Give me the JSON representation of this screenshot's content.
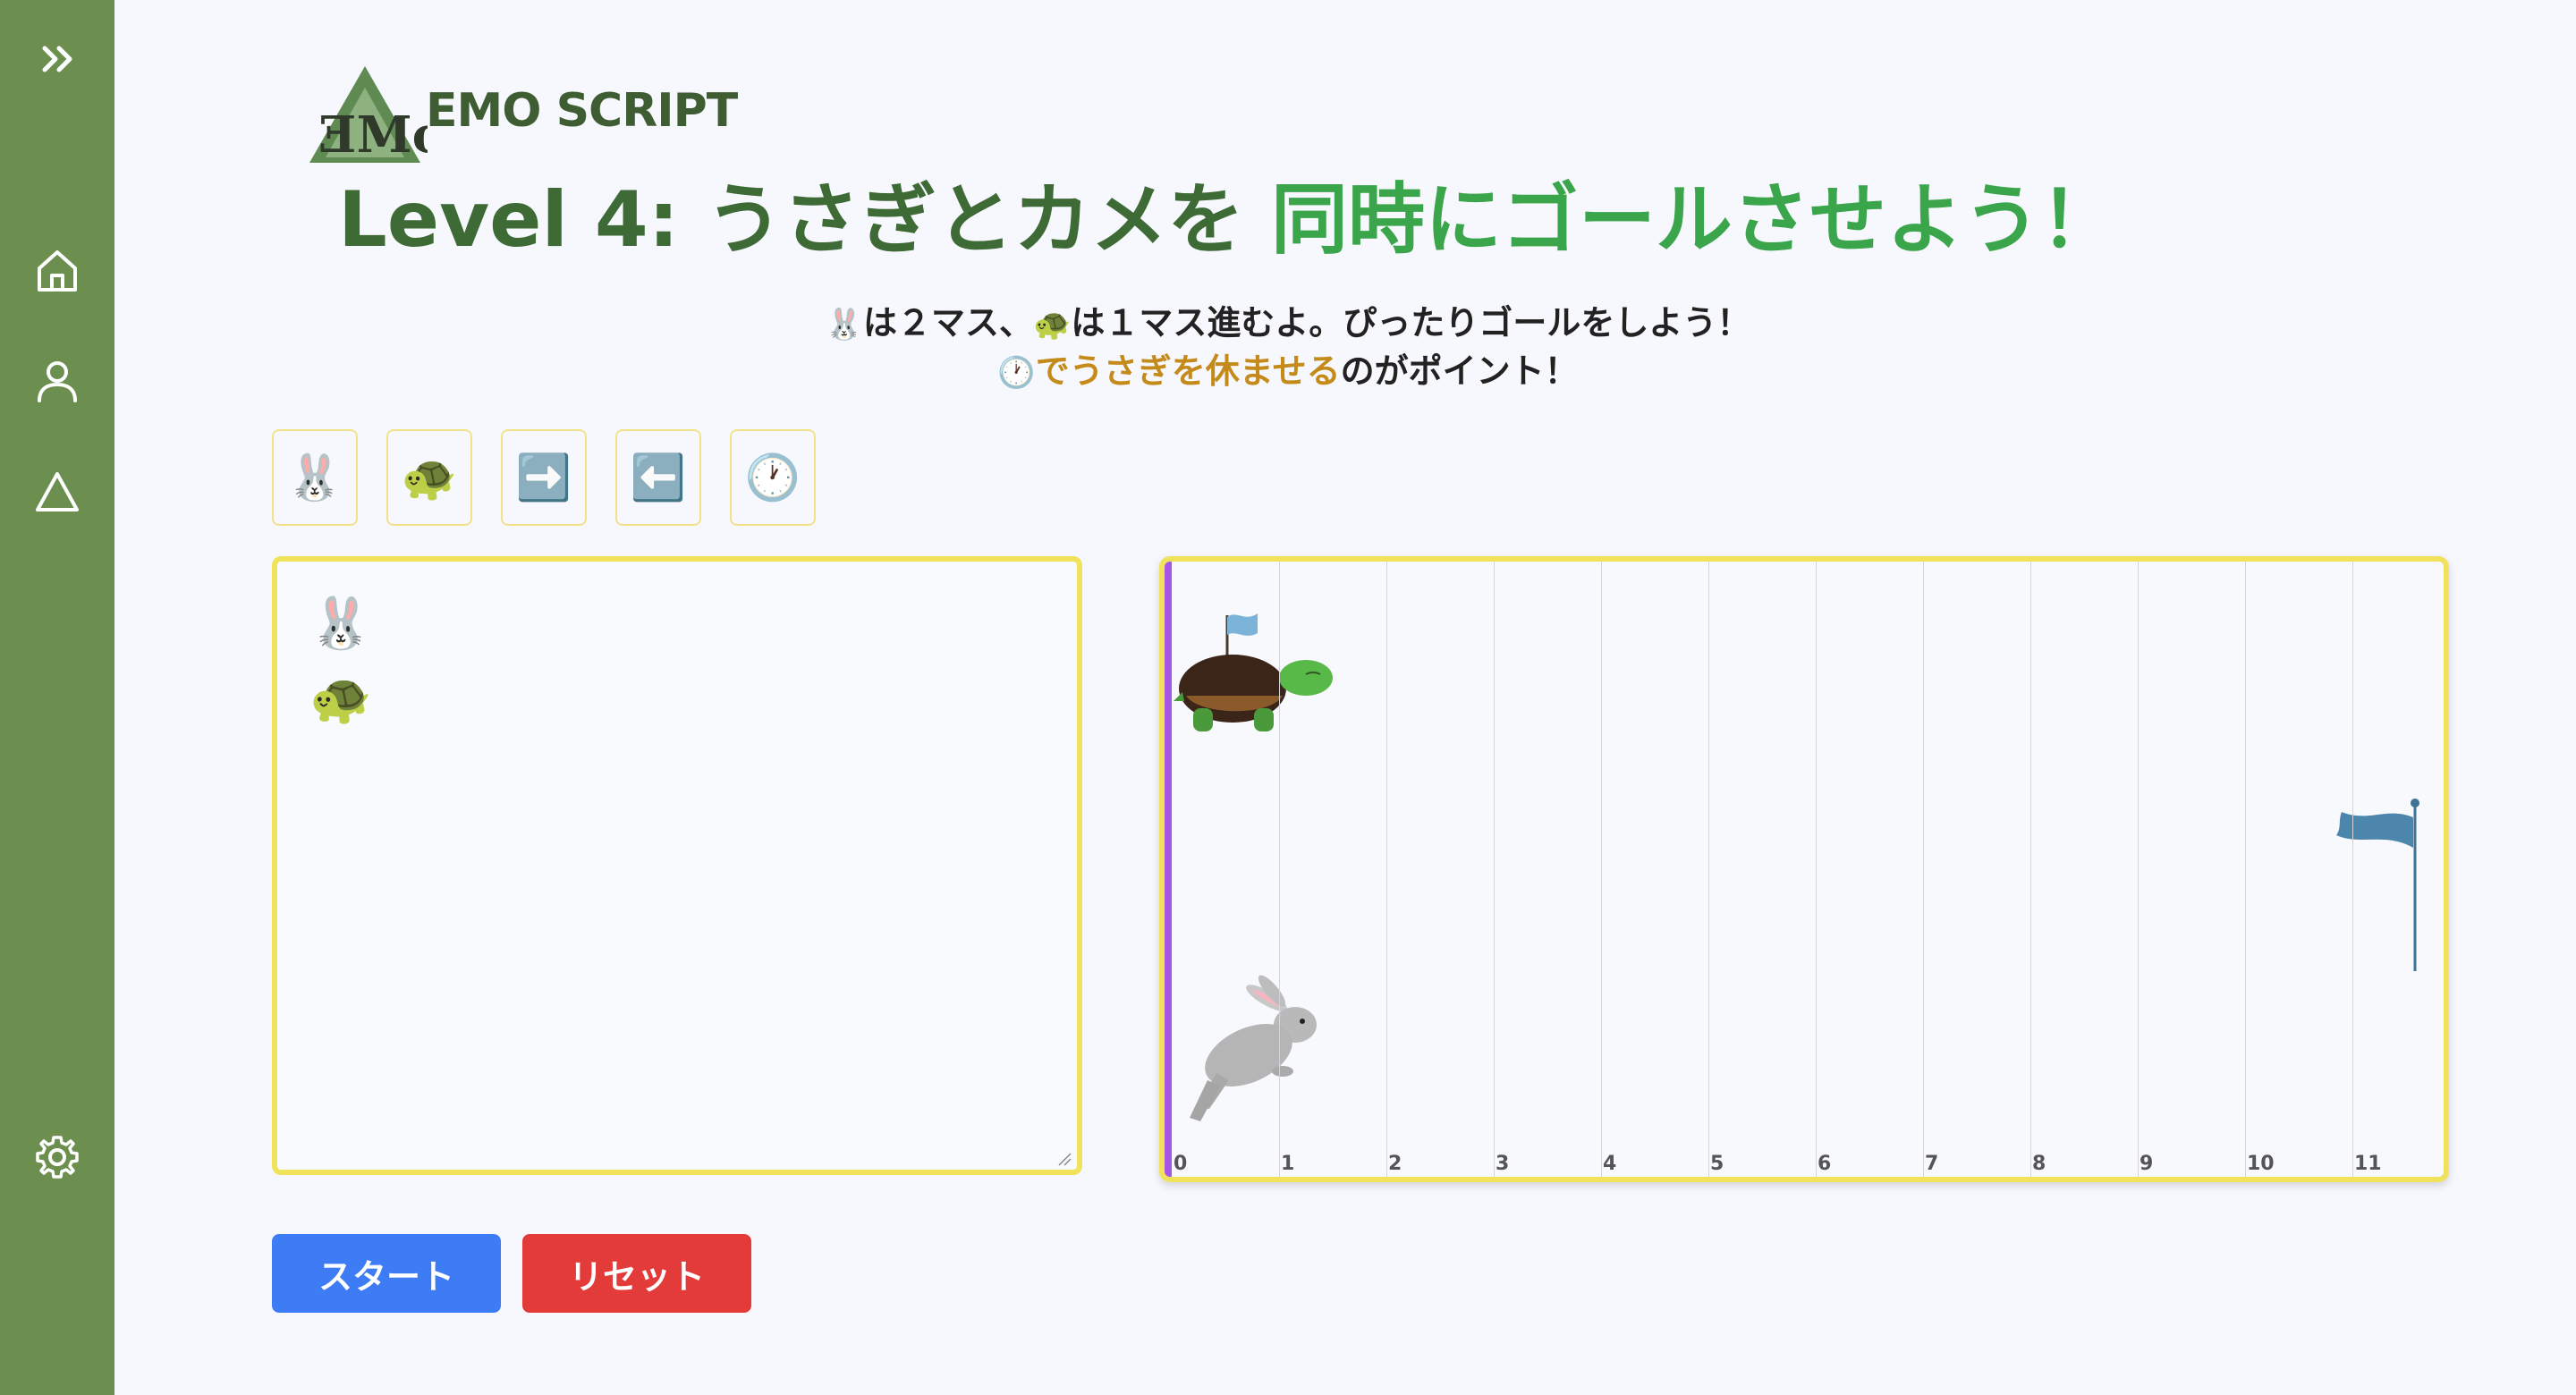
{
  "sidebar": {
    "expand_label": "expand",
    "items": [
      {
        "icon": "home-icon"
      },
      {
        "icon": "user-icon"
      },
      {
        "icon": "triangle-icon"
      }
    ],
    "settings_icon": "gear-icon",
    "color": "#6c8f4f"
  },
  "logo": {
    "mark": "ƎMo",
    "word": "EMO SCRIPT"
  },
  "title": {
    "part1": "Level 4: うさぎとカメを ",
    "part2": "同時にゴールさせよう！"
  },
  "subtitle": {
    "line1_rabbit": "🐰",
    "line1_a": "は２マス、",
    "line1_turtle": "🐢",
    "line1_b": "は１マス進むよ。ぴったりゴールをしよう！",
    "line2_clock": "🕐",
    "line2_highlight": "でうさぎを休ませる",
    "line2_rest": "のがポイント！"
  },
  "palette": [
    {
      "glyph": "🐰",
      "name": "rabbit"
    },
    {
      "glyph": "🐢",
      "name": "turtle"
    },
    {
      "glyph": "➡️",
      "name": "right-arrow"
    },
    {
      "glyph": "⬅️",
      "name": "left-arrow"
    },
    {
      "glyph": "🕐",
      "name": "clock"
    }
  ],
  "editor": {
    "lines": [
      "🐰",
      "🐢"
    ]
  },
  "course": {
    "columns": [
      "0",
      "1",
      "2",
      "3",
      "4",
      "5",
      "6",
      "7",
      "8",
      "9",
      "10",
      "11"
    ],
    "turtle_position": 0,
    "rabbit_position": 0,
    "goal_column": 11
  },
  "buttons": {
    "start": "スタート",
    "reset": "リセット"
  },
  "colors": {
    "accent_green": "#3aa54a",
    "title_dark_green": "#3d6a35",
    "highlight_orange": "#c48a1a",
    "border_yellow": "#f0e25a",
    "start_blue": "#3e7cf5",
    "reset_red": "#e33a3a",
    "start_line_purple": "#a657e8"
  }
}
